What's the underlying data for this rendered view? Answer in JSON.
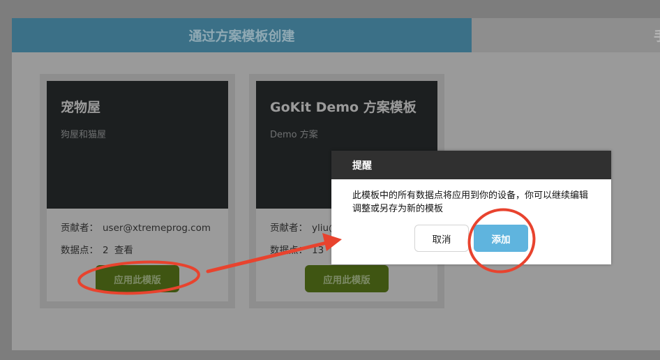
{
  "tabs": {
    "active_label": "通过方案模板创建",
    "inactive_label": "手"
  },
  "cards": [
    {
      "title": "宠物屋",
      "subtitle": "狗屋和猫屋",
      "contributor_label": "贡献者：",
      "contributor_value": "user@xtremeprog.com",
      "datapoints_label": "数据点：",
      "datapoints_value": "2",
      "view_link": "查看",
      "apply_button": "应用此模版"
    },
    {
      "title": "GoKit Demo 方案模板",
      "subtitle": "Demo 方案",
      "contributor_label": "贡献者：",
      "contributor_value": "yliu@",
      "datapoints_label": "数据点：",
      "datapoints_value": "13",
      "apply_button": "应用此模版"
    }
  ],
  "dialog": {
    "title": "提醒",
    "message": "此模板中的所有数据点将应用到你的设备，你可以继续编辑调整或另存为新的模板",
    "cancel_button": "取消",
    "confirm_button": "添加"
  },
  "colors": {
    "active_tab": "#3b7087",
    "apply_button": "#3f5512",
    "confirm_button": "#5fb4de",
    "annotation": "#e8432e"
  }
}
